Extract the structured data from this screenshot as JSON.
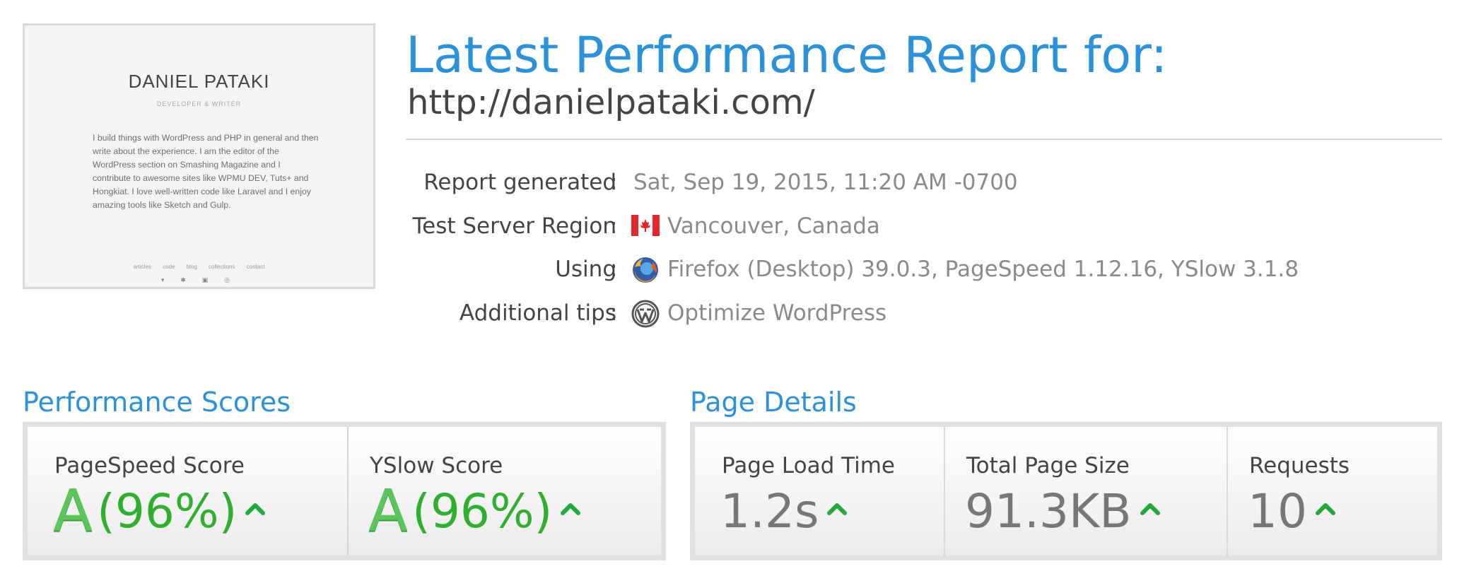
{
  "thumbnail": {
    "name": "DANIEL PATAKI",
    "subtitle": "DEVELOPER & WRITER",
    "bio": "I build things with WordPress and PHP in general and then write about the experience. I am the editor of the WordPress section on Smashing Magazine and I contribute to awesome sites like WPMU DEV, Tuts+ and Hongkiat. I love well-written code like Laravel and I enjoy amazing tools like Sketch and Gulp.",
    "links": "articles code blog collections contact",
    "social": "▾ ✱ ▣ ◎"
  },
  "header": {
    "title": "Latest Performance Report for:",
    "url": "http://danielpataki.com/"
  },
  "info": {
    "generated": {
      "label": "Report generated",
      "value": "Sat, Sep 19, 2015, 11:20 AM -0700"
    },
    "region": {
      "label": "Test Server Region",
      "value": "Vancouver, Canada",
      "icon": "canada-flag-icon"
    },
    "using": {
      "label": "Using",
      "value": "Firefox (Desktop) 39.0.3, PageSpeed 1.12.16, YSlow 3.1.8",
      "icon": "firefox-icon"
    },
    "tips": {
      "label": "Additional tips",
      "value": "Optimize WordPress",
      "icon": "wordpress-icon"
    },
    "colon": ":"
  },
  "performance": {
    "title": "Performance Scores",
    "pagespeed": {
      "label": "PageSpeed Score",
      "grade": "A",
      "percent": "(96%)"
    },
    "yslow": {
      "label": "YSlow Score",
      "grade": "A",
      "percent": "(96%)"
    }
  },
  "details": {
    "title": "Page Details",
    "load_time": {
      "label": "Page Load Time",
      "value": "1.2s"
    },
    "page_size": {
      "label": "Total Page Size",
      "value": "91.3KB"
    },
    "requests": {
      "label": "Requests",
      "value": "10"
    }
  },
  "colors": {
    "accent": "#2b91d9",
    "grade_green": "#5cc45c",
    "percent_green": "#2fae2f",
    "arrow_green": "#24a83a"
  }
}
